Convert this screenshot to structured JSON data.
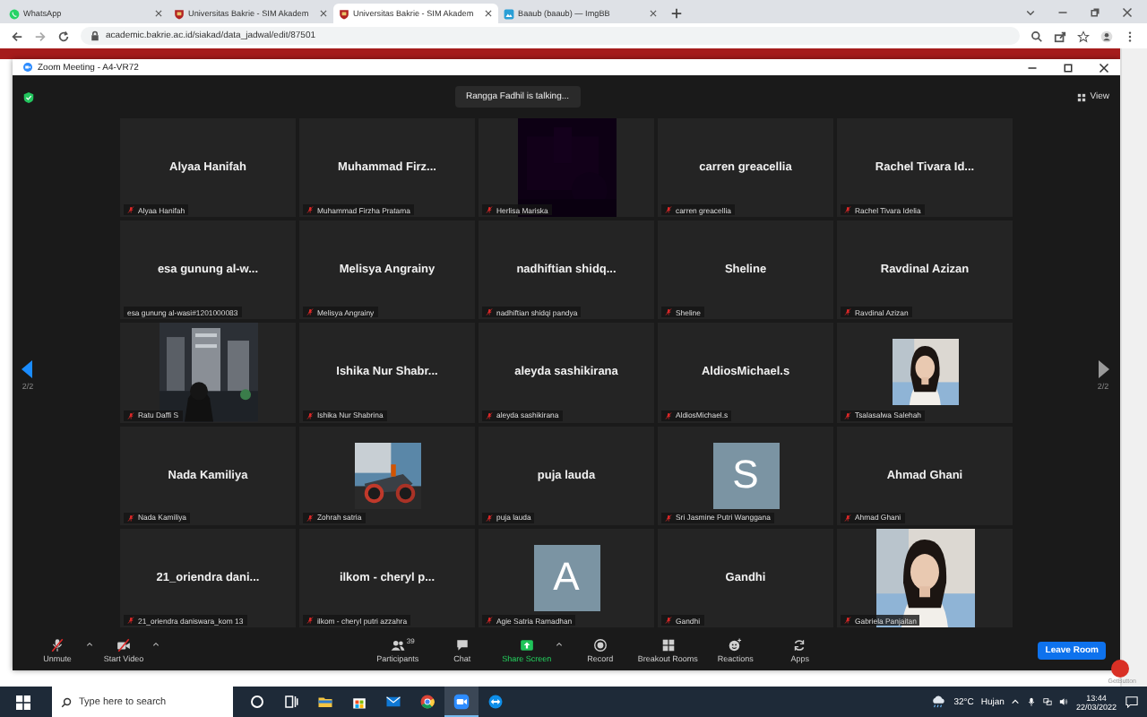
{
  "browser": {
    "tabs": [
      {
        "title": "WhatsApp",
        "kind": "whatsapp",
        "selected": false
      },
      {
        "title": "Universitas Bakrie - SIM Akadem",
        "kind": "university",
        "selected": false
      },
      {
        "title": "Universitas Bakrie - SIM Akadem",
        "kind": "university",
        "selected": true
      },
      {
        "title": "Baaub (baaub) — ImgBB",
        "kind": "imgbb",
        "selected": false
      }
    ],
    "address": "academic.bakrie.ac.id/siakad/data_jadwal/edit/87501"
  },
  "zoom": {
    "title": "Zoom Meeting - A4-VR72",
    "talking": "Rangga Fadhil is talking...",
    "view": "View",
    "page_left": "2/2",
    "page_right": "2/2",
    "tiles": [
      {
        "kind": "name",
        "name": "Alyaa Hanifah",
        "label": "Alyaa Hanifah",
        "muted": true
      },
      {
        "kind": "name",
        "name": "Muhammad Firz...",
        "label": "Muhammad Firzha Pratama",
        "muted": true
      },
      {
        "kind": "video",
        "label": "Herlisa Mariska",
        "muted": true
      },
      {
        "kind": "name",
        "name": "carren greacellia",
        "label": "carren greacellia",
        "muted": true
      },
      {
        "kind": "name",
        "name": "Rachel Tivara Id...",
        "label": "Rachel Tivara Idelia",
        "muted": true
      },
      {
        "kind": "name",
        "name": "esa gunung al-w...",
        "label": "esa gunung al-wasi#1201000083",
        "muted": false
      },
      {
        "kind": "name",
        "name": "Melisya Angrainy",
        "label": "Melisya Angrainy",
        "muted": true
      },
      {
        "kind": "name",
        "name": "nadhiftian shidq...",
        "label": "nadhiftian shidqi pandya",
        "muted": true
      },
      {
        "kind": "name",
        "name": "Sheline",
        "label": "Sheline",
        "muted": true
      },
      {
        "kind": "name",
        "name": "Ravdinal Azizan",
        "label": "Ravdinal Azizan",
        "muted": true
      },
      {
        "kind": "video",
        "label": "Ratu Daffi S",
        "muted": true
      },
      {
        "kind": "name",
        "name": "Ishika Nur Shabr...",
        "label": "Ishika Nur Shabrina",
        "muted": true
      },
      {
        "kind": "name",
        "name": "aleyda sashikirana",
        "label": "aleyda sashikirana",
        "muted": true
      },
      {
        "kind": "name",
        "name": "AldiosMichael.s",
        "label": "AldiosMichael.s",
        "muted": true
      },
      {
        "label": "Tsalasalwa Salehah",
        "muted": true
      },
      {
        "kind": "name",
        "name": "Nada Kamiliya",
        "label": "Nada Kamiliya",
        "muted": true
      },
      {
        "label": "Zohrah satria",
        "muted": true
      },
      {
        "kind": "name",
        "name": "puja lauda",
        "label": "puja lauda",
        "muted": true
      },
      {
        "kind": "avatar",
        "letter": "S",
        "label": "Sri Jasmine Putri Wanggana",
        "muted": true
      },
      {
        "kind": "name",
        "name": "Ahmad Ghani",
        "label": "Ahmad Ghani",
        "muted": true
      },
      {
        "kind": "name",
        "name": "21_oriendra dani...",
        "label": "21_oriendra daniswara_kom 13",
        "muted": true
      },
      {
        "kind": "name",
        "name": "ilkom - cheryl p...",
        "label": "ilkom - cheryl putri azzahra",
        "muted": true
      },
      {
        "kind": "avatar",
        "letter": "A",
        "label": "Agie Satria Ramadhan",
        "muted": true
      },
      {
        "kind": "name",
        "name": "Gandhi",
        "label": "Gandhi",
        "muted": true
      },
      {
        "kind": "video",
        "label": "Gabriela Panjaitan",
        "muted": true
      }
    ],
    "toolbar_left": [
      {
        "kind": "mic",
        "label": "Unmute"
      },
      {
        "kind": "camera",
        "label": "Start Video"
      }
    ],
    "toolbar_center": [
      {
        "kind": "participants",
        "label": "Participants",
        "count": "39"
      },
      {
        "kind": "chat",
        "label": "Chat"
      },
      {
        "kind": "share",
        "label": "Share Screen"
      },
      {
        "kind": "record",
        "label": "Record"
      },
      {
        "kind": "breakout",
        "label": "Breakout Rooms"
      },
      {
        "kind": "reactions",
        "label": "Reactions"
      },
      {
        "kind": "apps",
        "label": "Apps"
      }
    ],
    "leave": "Leave Room"
  },
  "page_behind": {
    "widget": "GetButton"
  },
  "taskbar": {
    "search": {
      "placeholder": "Type here to search"
    },
    "apps": [
      {
        "kind": "cortana",
        "selected": false
      },
      {
        "kind": "taskview",
        "selected": false
      },
      {
        "kind": "explorer",
        "selected": false
      },
      {
        "kind": "store",
        "selected": false
      },
      {
        "kind": "mail",
        "selected": false
      },
      {
        "kind": "chrome",
        "selected": false
      },
      {
        "kind": "zoom",
        "selected": true
      },
      {
        "kind": "teamviewer",
        "selected": false
      }
    ],
    "temperature": "32°C",
    "weather": "Hujan",
    "time": "13:44",
    "date": "22/03/2022"
  }
}
